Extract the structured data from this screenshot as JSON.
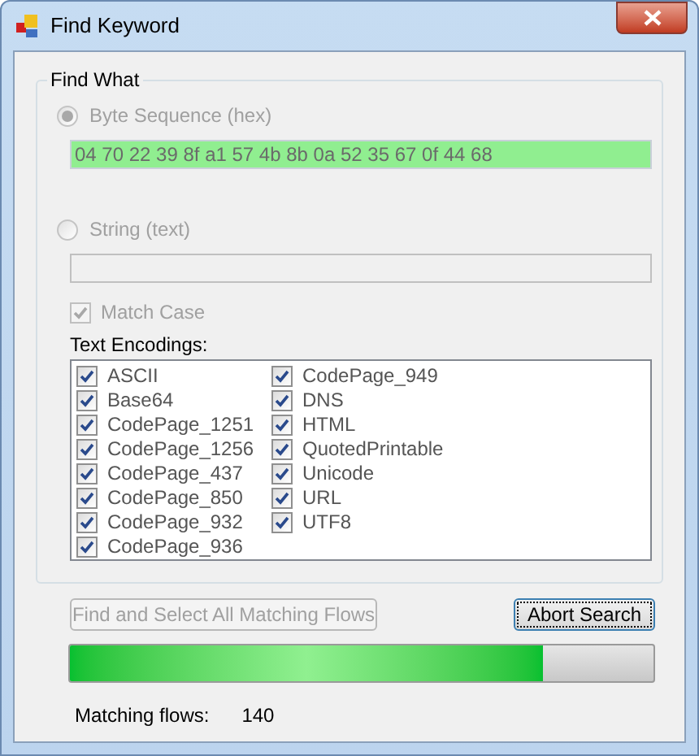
{
  "window": {
    "title": "Find Keyword"
  },
  "group": {
    "title": "Find What"
  },
  "options": [
    {
      "label": "Byte Sequence (hex)",
      "selected": true,
      "disabled": true,
      "value": "04 70 22 39 8f a1 57 4b 8b 0a 52 35 67 0f 44 68"
    },
    {
      "label": "String (text)",
      "selected": false,
      "disabled": true
    }
  ],
  "match_case": {
    "label": "Match Case",
    "checked": true,
    "disabled": true
  },
  "encodings_label": "Text Encodings:",
  "encodings": [
    {
      "label": "ASCII",
      "checked": true
    },
    {
      "label": "Base64",
      "checked": true
    },
    {
      "label": "CodePage_1251",
      "checked": true
    },
    {
      "label": "CodePage_1256",
      "checked": true
    },
    {
      "label": "CodePage_437",
      "checked": true
    },
    {
      "label": "CodePage_850",
      "checked": true
    },
    {
      "label": "CodePage_932",
      "checked": true
    },
    {
      "label": "CodePage_936",
      "checked": true
    },
    {
      "label": "CodePage_949",
      "checked": true
    },
    {
      "label": "DNS",
      "checked": true
    },
    {
      "label": "HTML",
      "checked": true
    },
    {
      "label": "QuotedPrintable",
      "checked": true
    },
    {
      "label": "Unicode",
      "checked": true
    },
    {
      "label": "URL",
      "checked": true
    },
    {
      "label": "UTF8",
      "checked": true
    }
  ],
  "buttons": [
    {
      "label": "Find and Select All Matching Flows",
      "disabled": true
    },
    {
      "label": "Abort Search",
      "disabled": false
    }
  ],
  "progress": {
    "level": 0.81
  },
  "result": {
    "label": "Matching flows:",
    "value": "140"
  }
}
